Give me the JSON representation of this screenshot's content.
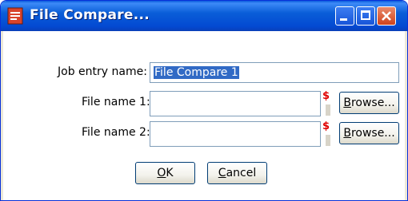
{
  "window": {
    "title": "File Compare...",
    "icons": {
      "app": "file-compare-app-icon",
      "minimize": "minimize-icon",
      "maximize": "maximize-icon",
      "close": "close-icon"
    }
  },
  "form": {
    "job_entry_label": "Job entry name:",
    "job_entry_value": "File Compare 1",
    "file1_label": "File name 1:",
    "file1_value": "",
    "file2_label": "File name 2:",
    "file2_value": "",
    "required_marker": "$",
    "browse_label_rest": "rowse...",
    "browse_label_mnemonic": "B"
  },
  "buttons": {
    "ok_mnemonic": "O",
    "ok_rest": "K",
    "cancel_mnemonic": "C",
    "cancel_rest": "ancel"
  },
  "colors": {
    "titlebar": "#0a5ed8",
    "selection": "#316ac5",
    "required": "#e00000"
  }
}
